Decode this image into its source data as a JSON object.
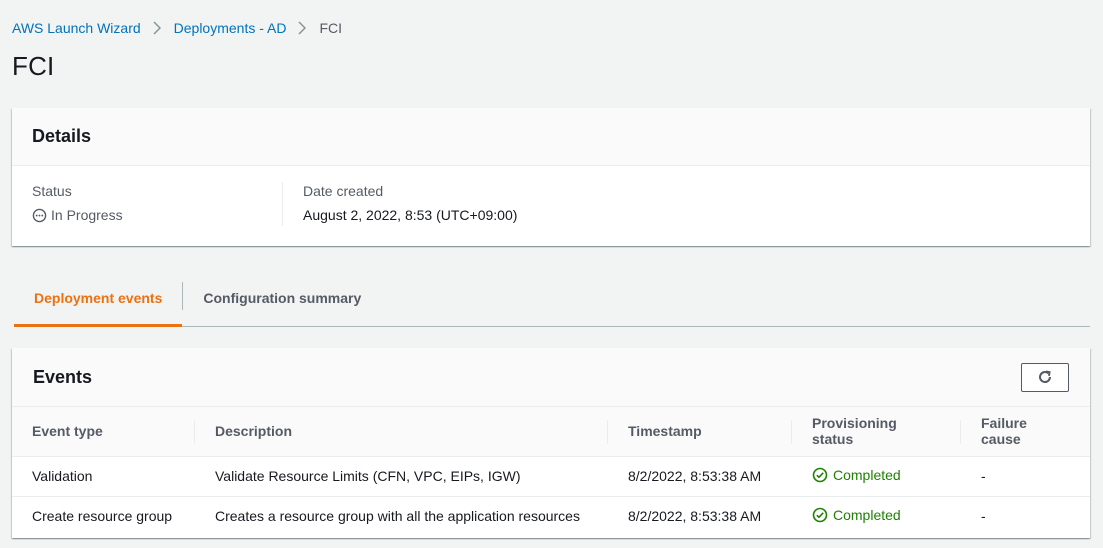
{
  "breadcrumb": {
    "items": [
      "AWS Launch Wizard",
      "Deployments - AD"
    ],
    "current": "FCI"
  },
  "page_title": "FCI",
  "details": {
    "title": "Details",
    "status_label": "Status",
    "status_value": "In Progress",
    "date_label": "Date created",
    "date_value": "August 2, 2022, 8:53 (UTC+09:00)"
  },
  "tabs": [
    {
      "label": "Deployment events",
      "active": true
    },
    {
      "label": "Configuration summary",
      "active": false
    }
  ],
  "events": {
    "title": "Events",
    "columns": [
      "Event type",
      "Description",
      "Timestamp",
      "Provisioning status",
      "Failure cause"
    ],
    "rows": [
      {
        "type": "Validation",
        "description": "Validate Resource Limits (CFN, VPC, EIPs, IGW)",
        "timestamp": "8/2/2022, 8:53:38 AM",
        "status": "Completed",
        "failure": "-"
      },
      {
        "type": "Create resource group",
        "description": "Creates a resource group with all the application resources",
        "timestamp": "8/2/2022, 8:53:38 AM",
        "status": "Completed",
        "failure": "-"
      }
    ]
  },
  "colors": {
    "link": "#0073bb",
    "accent": "#ec7211",
    "success": "#1d8102"
  }
}
